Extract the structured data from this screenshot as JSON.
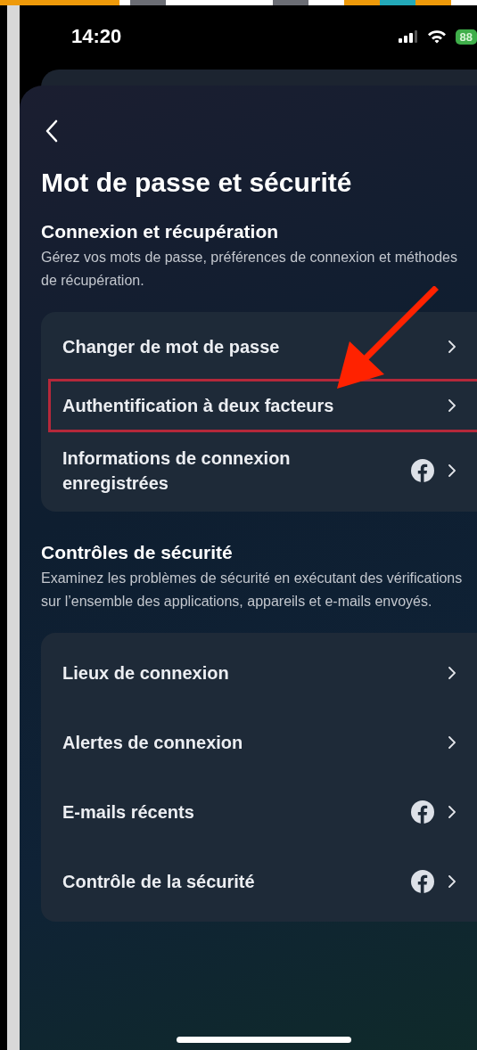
{
  "status_bar": {
    "time": "14:20",
    "battery": "88"
  },
  "title": "Mot de passe et sécurité",
  "sections": [
    {
      "title": "Connexion et récupération",
      "description": "Gérez vos mots de passe, préférences de connexion et méthodes de récupération.",
      "items": [
        {
          "label": "Changer de mot de passe",
          "facebook": false,
          "highlighted": false
        },
        {
          "label": "Authentification à deux facteurs",
          "facebook": false,
          "highlighted": true
        },
        {
          "label": "Informations de connexion enregistrées",
          "facebook": true,
          "highlighted": false
        }
      ]
    },
    {
      "title": "Contrôles de sécurité",
      "description": "Examinez les problèmes de sécurité en exécutant des vérifications sur l’ensemble des applications, appareils et e-mails envoyés.",
      "items": [
        {
          "label": "Lieux de connexion",
          "facebook": false,
          "highlighted": false
        },
        {
          "label": "Alertes de connexion",
          "facebook": false,
          "highlighted": false
        },
        {
          "label": "E-mails récents",
          "facebook": true,
          "highlighted": false
        },
        {
          "label": "Contrôle de la sécurité",
          "facebook": true,
          "highlighted": false
        }
      ]
    }
  ]
}
